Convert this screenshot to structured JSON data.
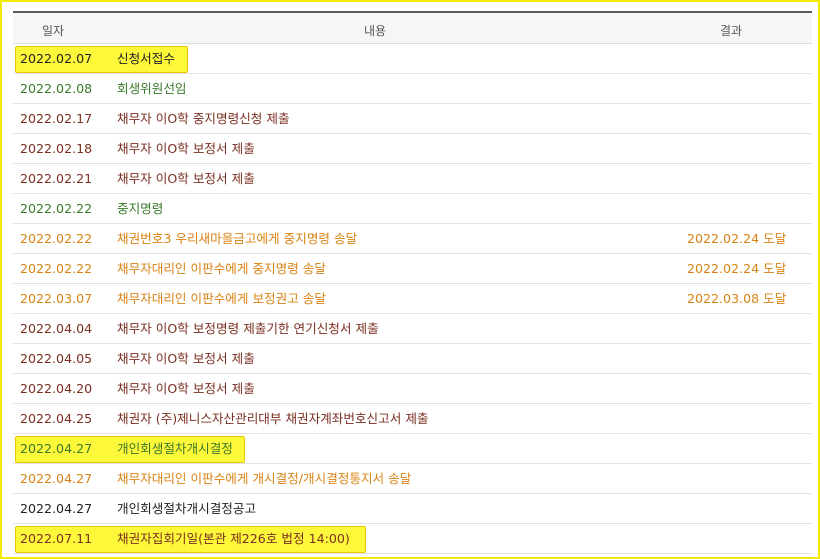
{
  "headers": {
    "date": "일자",
    "content": "내용",
    "result": "결과"
  },
  "colors": {
    "brown": "#7a2f21",
    "green": "#3a7a2b",
    "orange": "#d98314",
    "dark": "#222222",
    "highlight": "#fdf83a"
  },
  "rows": [
    {
      "date": "2022.02.07",
      "content": "신청서접수",
      "result": "",
      "tone": "dark",
      "highlighted": true
    },
    {
      "date": "2022.02.08",
      "content": "회생위원선임",
      "result": "",
      "tone": "green",
      "highlighted": false
    },
    {
      "date": "2022.02.17",
      "content": "채무자 이O학 중지명령신청 제출",
      "result": "",
      "tone": "brown",
      "highlighted": false
    },
    {
      "date": "2022.02.18",
      "content": "채무자 이O학 보정서 제출",
      "result": "",
      "tone": "brown",
      "highlighted": false
    },
    {
      "date": "2022.02.21",
      "content": "채무자 이O학 보정서 제출",
      "result": "",
      "tone": "brown",
      "highlighted": false
    },
    {
      "date": "2022.02.22",
      "content": "중지명령",
      "result": "",
      "tone": "green",
      "highlighted": false
    },
    {
      "date": "2022.02.22",
      "content": "채권번호3 우리새마을금고에게 중지명령 송달",
      "result": "2022.02.24 도달",
      "tone": "orange",
      "highlighted": false
    },
    {
      "date": "2022.02.22",
      "content": "채무자대리인 이판수에게 중지명령 송달",
      "result": "2022.02.24 도달",
      "tone": "orange",
      "highlighted": false
    },
    {
      "date": "2022.03.07",
      "content": "채무자대리인 이판수에게 보정권고 송달",
      "result": "2022.03.08 도달",
      "tone": "orange",
      "highlighted": false
    },
    {
      "date": "2022.04.04",
      "content": "채무자 이O학 보정명령 제출기한 연기신청서 제출",
      "result": "",
      "tone": "brown",
      "highlighted": false
    },
    {
      "date": "2022.04.05",
      "content": "채무자 이O학 보정서 제출",
      "result": "",
      "tone": "brown",
      "highlighted": false
    },
    {
      "date": "2022.04.20",
      "content": "채무자 이O학 보정서 제출",
      "result": "",
      "tone": "brown",
      "highlighted": false
    },
    {
      "date": "2022.04.25",
      "content": "채권자 (주)제니스자산관리대부 채권자계좌번호신고서 제출",
      "result": "",
      "tone": "brown",
      "highlighted": false
    },
    {
      "date": "2022.04.27",
      "content": "개인회생절차개시결정",
      "result": "",
      "tone": "green",
      "highlighted": true
    },
    {
      "date": "2022.04.27",
      "content": "채무자대리인 이판수에게 개시결정/개시결정통지서 송달",
      "result": "",
      "tone": "orange",
      "highlighted": false
    },
    {
      "date": "2022.04.27",
      "content": "개인회생절차개시결정공고",
      "result": "",
      "tone": "dark",
      "highlighted": false
    },
    {
      "date": "2022.07.11",
      "content": "채권자집회기일(본관 제226호 법정 14:00)",
      "result": "",
      "tone": "brown",
      "highlighted": true
    }
  ]
}
